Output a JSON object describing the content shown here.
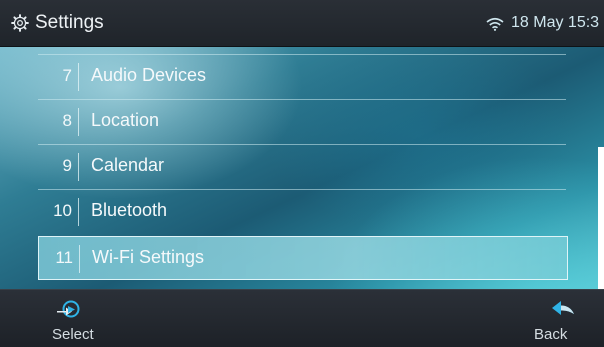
{
  "header": {
    "title": "Settings",
    "clock": "18 May 15:3"
  },
  "menu": {
    "items": [
      {
        "number": "7",
        "label": "Audio Devices"
      },
      {
        "number": "8",
        "label": "Location"
      },
      {
        "number": "9",
        "label": "Calendar"
      },
      {
        "number": "10",
        "label": "Bluetooth"
      },
      {
        "number": "11",
        "label": "Wi-Fi Settings",
        "selected": true
      }
    ]
  },
  "softkeys": {
    "left": {
      "label": "Select",
      "icon": "select-arrow-icon"
    },
    "right": {
      "label": "Back",
      "icon": "back-arrow-icon"
    }
  },
  "colors": {
    "header_bg": "#22272d",
    "accent": "#2fb3e6",
    "selection": "#8fd0dc"
  }
}
